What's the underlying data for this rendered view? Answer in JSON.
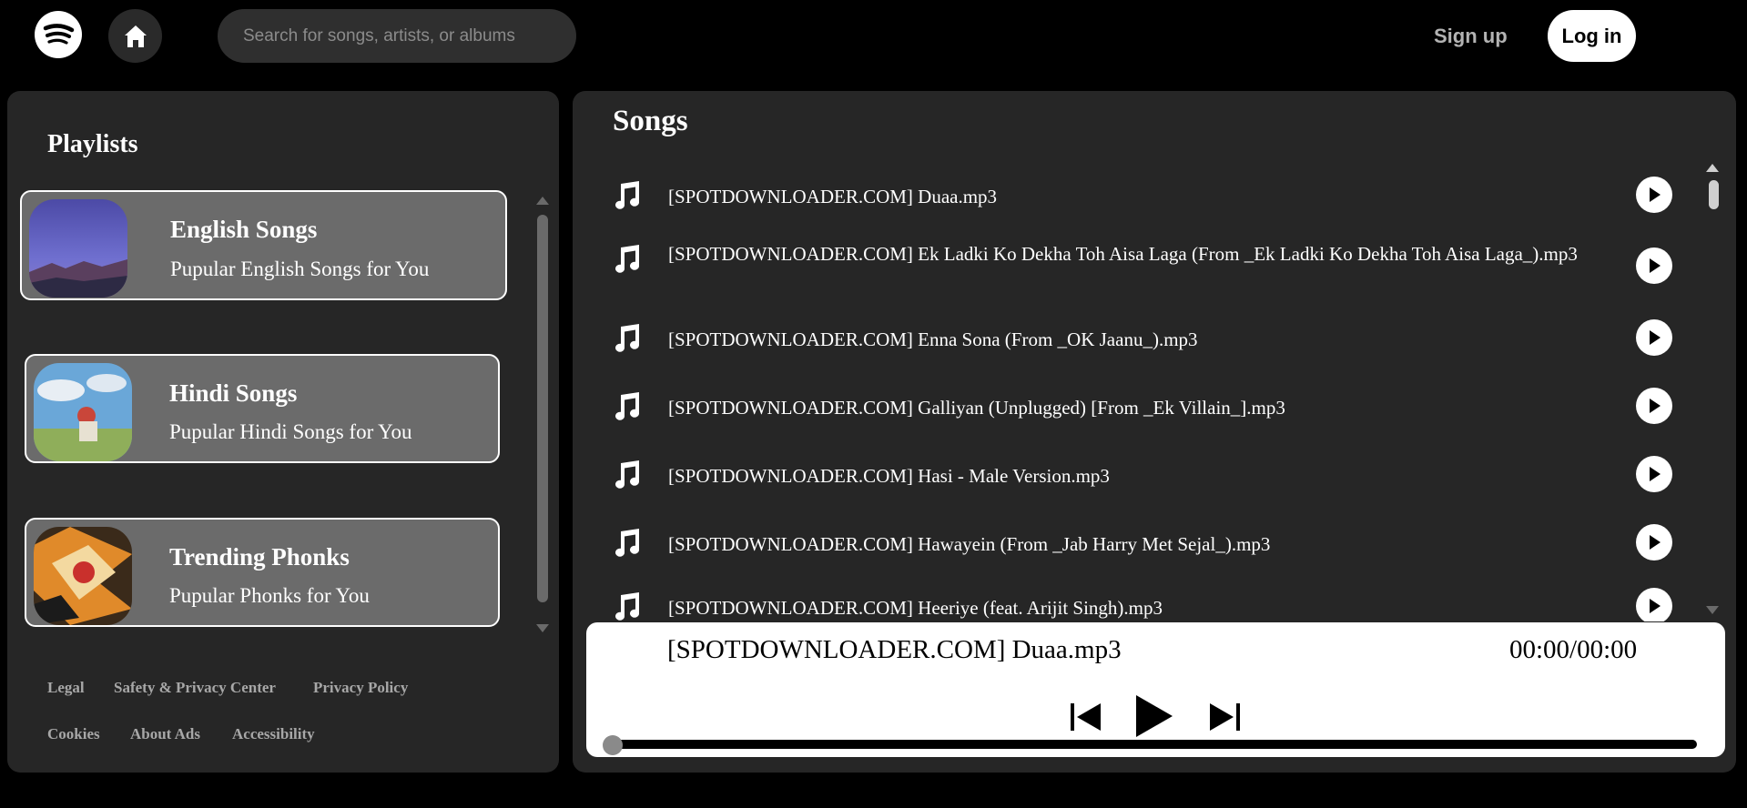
{
  "header": {
    "search_placeholder": "Search for songs, artists, or albums",
    "signup_label": "Sign up",
    "login_label": "Log in"
  },
  "sidebar": {
    "title": "Playlists",
    "playlists": [
      {
        "title": "English Songs",
        "description": "Pupular English Songs for You"
      },
      {
        "title": "Hindi Songs",
        "description": "Pupular Hindi Songs for You"
      },
      {
        "title": "Trending Phonks",
        "description": "Pupular Phonks for You"
      }
    ],
    "footer_links": [
      "Legal",
      "Safety & Privacy Center",
      "Privacy Policy",
      "Cookies",
      "About Ads",
      "Accessibility"
    ]
  },
  "main": {
    "title": "Songs",
    "songs": [
      "[SPOTDOWNLOADER.COM] Duaa.mp3",
      "[SPOTDOWNLOADER.COM] Ek Ladki Ko Dekha Toh Aisa Laga (From _Ek Ladki Ko Dekha Toh Aisa Laga_).mp3",
      "[SPOTDOWNLOADER.COM] Enna Sona (From _OK Jaanu_).mp3",
      "[SPOTDOWNLOADER.COM] Galliyan (Unplugged) [From _Ek Villain_].mp3",
      "[SPOTDOWNLOADER.COM] Hasi - Male Version.mp3",
      "[SPOTDOWNLOADER.COM] Hawayein (From _Jab Harry Met Sejal_).mp3",
      "[SPOTDOWNLOADER.COM] Heeriye (feat. Arijit Singh).mp3"
    ]
  },
  "player": {
    "now_playing": "[SPOTDOWNLOADER.COM] Duaa.mp3",
    "time": "00:00/00:00",
    "progress": 0
  },
  "colors": {
    "background": "#000000",
    "panel": "#262626",
    "card": "#6b6b6b",
    "muted_text": "#a7a7a7"
  }
}
